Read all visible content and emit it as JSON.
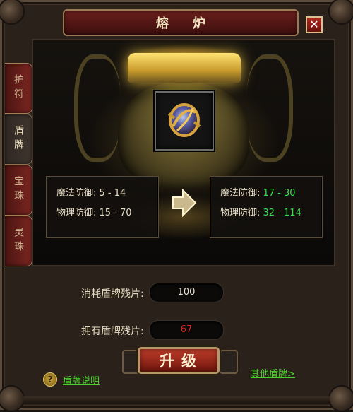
{
  "window": {
    "title": "熔 炉",
    "close_label": "✕"
  },
  "tabs": [
    {
      "label": "护符",
      "active": false
    },
    {
      "label": "盾牌",
      "active": true
    },
    {
      "label": "宝珠",
      "active": false
    },
    {
      "label": "灵珠",
      "active": false
    }
  ],
  "item": {
    "icon": "shield-item-icon"
  },
  "stats_before": {
    "magic_label": "魔法防御:",
    "magic_value": "5 - 14",
    "physical_label": "物理防御:",
    "physical_value": "15 - 70"
  },
  "stats_after": {
    "magic_label": "魔法防御:",
    "magic_value": "17 - 30",
    "physical_label": "物理防御:",
    "physical_value": "32 - 114"
  },
  "form": {
    "cost_label": "消耗盾牌残片:",
    "cost_value": "100",
    "owned_label": "拥有盾牌残片:",
    "owned_value": "67"
  },
  "actions": {
    "upgrade_label": "升级",
    "help_icon": "?",
    "help_link": "盾牌说明",
    "other_link": "其他盾牌>"
  },
  "colors": {
    "upgrade_green": "#37e04b",
    "insufficient_red": "#d9261f",
    "link_green": "#4bd12d"
  }
}
